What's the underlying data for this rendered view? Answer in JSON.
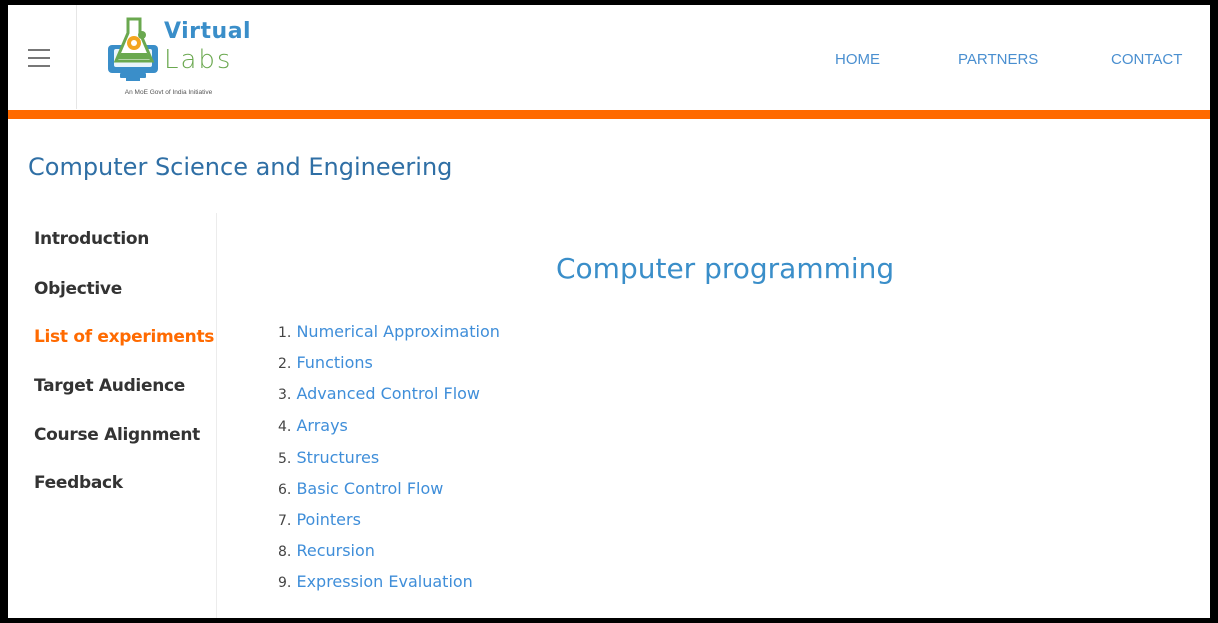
{
  "header": {
    "logo": {
      "line1": "Virtual",
      "line2": "Labs",
      "tagline": "An MoE Govt of India Initiative"
    },
    "nav": {
      "home": "HOME",
      "partners": "PARTNERS",
      "contact": "CONTACT"
    },
    "accent_color": "#ff6a00"
  },
  "page_title": "Computer Science and Engineering",
  "sidebar": {
    "items": [
      {
        "label": "Introduction",
        "active": false
      },
      {
        "label": "Objective",
        "active": false
      },
      {
        "label": "List of experiments",
        "active": true
      },
      {
        "label": "Target Audience",
        "active": false
      },
      {
        "label": "Course Alignment",
        "active": false
      },
      {
        "label": "Feedback",
        "active": false
      }
    ]
  },
  "content": {
    "title": "Computer programming",
    "experiments": [
      {
        "num": "1.",
        "label": "Numerical Approximation"
      },
      {
        "num": "2.",
        "label": "Functions"
      },
      {
        "num": "3.",
        "label": "Advanced Control Flow"
      },
      {
        "num": "4.",
        "label": "Arrays"
      },
      {
        "num": "5.",
        "label": "Structures"
      },
      {
        "num": "6.",
        "label": "Basic Control Flow"
      },
      {
        "num": "7.",
        "label": "Pointers"
      },
      {
        "num": "8.",
        "label": "Recursion"
      },
      {
        "num": "9.",
        "label": "Expression Evaluation"
      }
    ]
  }
}
